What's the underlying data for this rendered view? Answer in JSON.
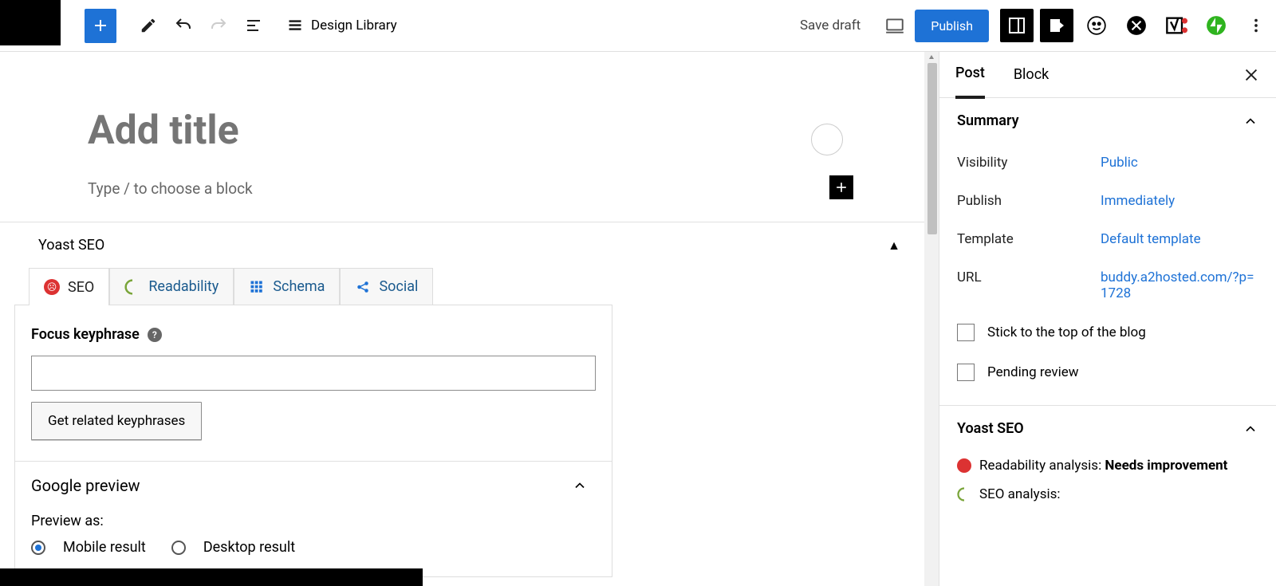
{
  "toolbar": {
    "design_library": "Design Library",
    "save_draft": "Save draft",
    "publish": "Publish"
  },
  "editor": {
    "title_placeholder": "Add title",
    "block_prompt": "Type / to choose a block"
  },
  "yoast": {
    "panel_title": "Yoast SEO",
    "tabs": {
      "seo": "SEO",
      "readability": "Readability",
      "schema": "Schema",
      "social": "Social"
    },
    "focus_label": "Focus keyphrase",
    "related_btn": "Get related keyphrases",
    "google_preview": "Google preview",
    "preview_as": "Preview as:",
    "mobile": "Mobile result",
    "desktop": "Desktop result"
  },
  "sidebar": {
    "tabs": {
      "post": "Post",
      "block": "Block"
    },
    "summary": "Summary",
    "rows": {
      "visibility_label": "Visibility",
      "visibility_value": "Public",
      "publish_label": "Publish",
      "publish_value": "Immediately",
      "template_label": "Template",
      "template_value": "Default template",
      "url_label": "URL",
      "url_value": "buddy.a2hosted.com/?p=1728"
    },
    "stick_top": "Stick to the top of the blog",
    "pending": "Pending review",
    "yoast_title": "Yoast SEO",
    "readability_label": "Readability analysis: ",
    "readability_status": "Needs improvement",
    "seo_label": "SEO analysis:"
  }
}
